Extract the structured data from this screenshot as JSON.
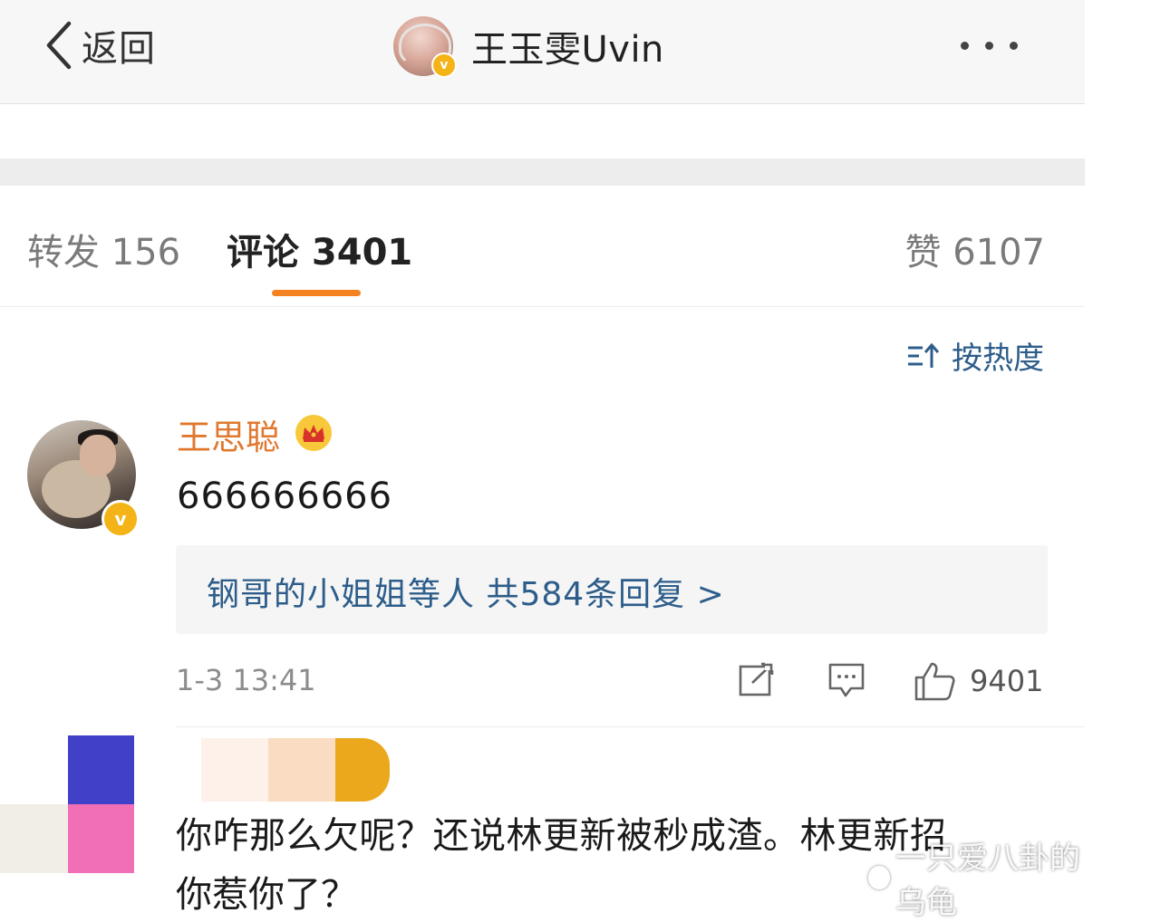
{
  "header": {
    "back_label": "返回",
    "title": "王玉雯Uvin"
  },
  "tabs": {
    "repost": "转发 156",
    "comments": "评论 3401",
    "likes": "赞 6107"
  },
  "sort": {
    "label": "按热度"
  },
  "comments": [
    {
      "author": "王思聪",
      "text": "666666666",
      "replies_link": "钢哥的小姐姐等人  共584条回复 >",
      "time": "1-3 13:41",
      "like_count": "9401"
    },
    {
      "text_line1": "你咋那么欠呢？还说林更新被秒成渣。林更新招",
      "text_line2": "你惹你了？"
    }
  ],
  "watermark": "一只爱八卦的乌龟",
  "colors": {
    "accent_orange": "#f58220",
    "link_blue": "#2d5d8a",
    "verified_gold": "#f4b316"
  },
  "icons": [
    "chevron-left-icon",
    "more-icon",
    "verified-icon",
    "sort-icon",
    "crown-icon",
    "share-icon",
    "comment-icon",
    "thumb-up-icon"
  ]
}
